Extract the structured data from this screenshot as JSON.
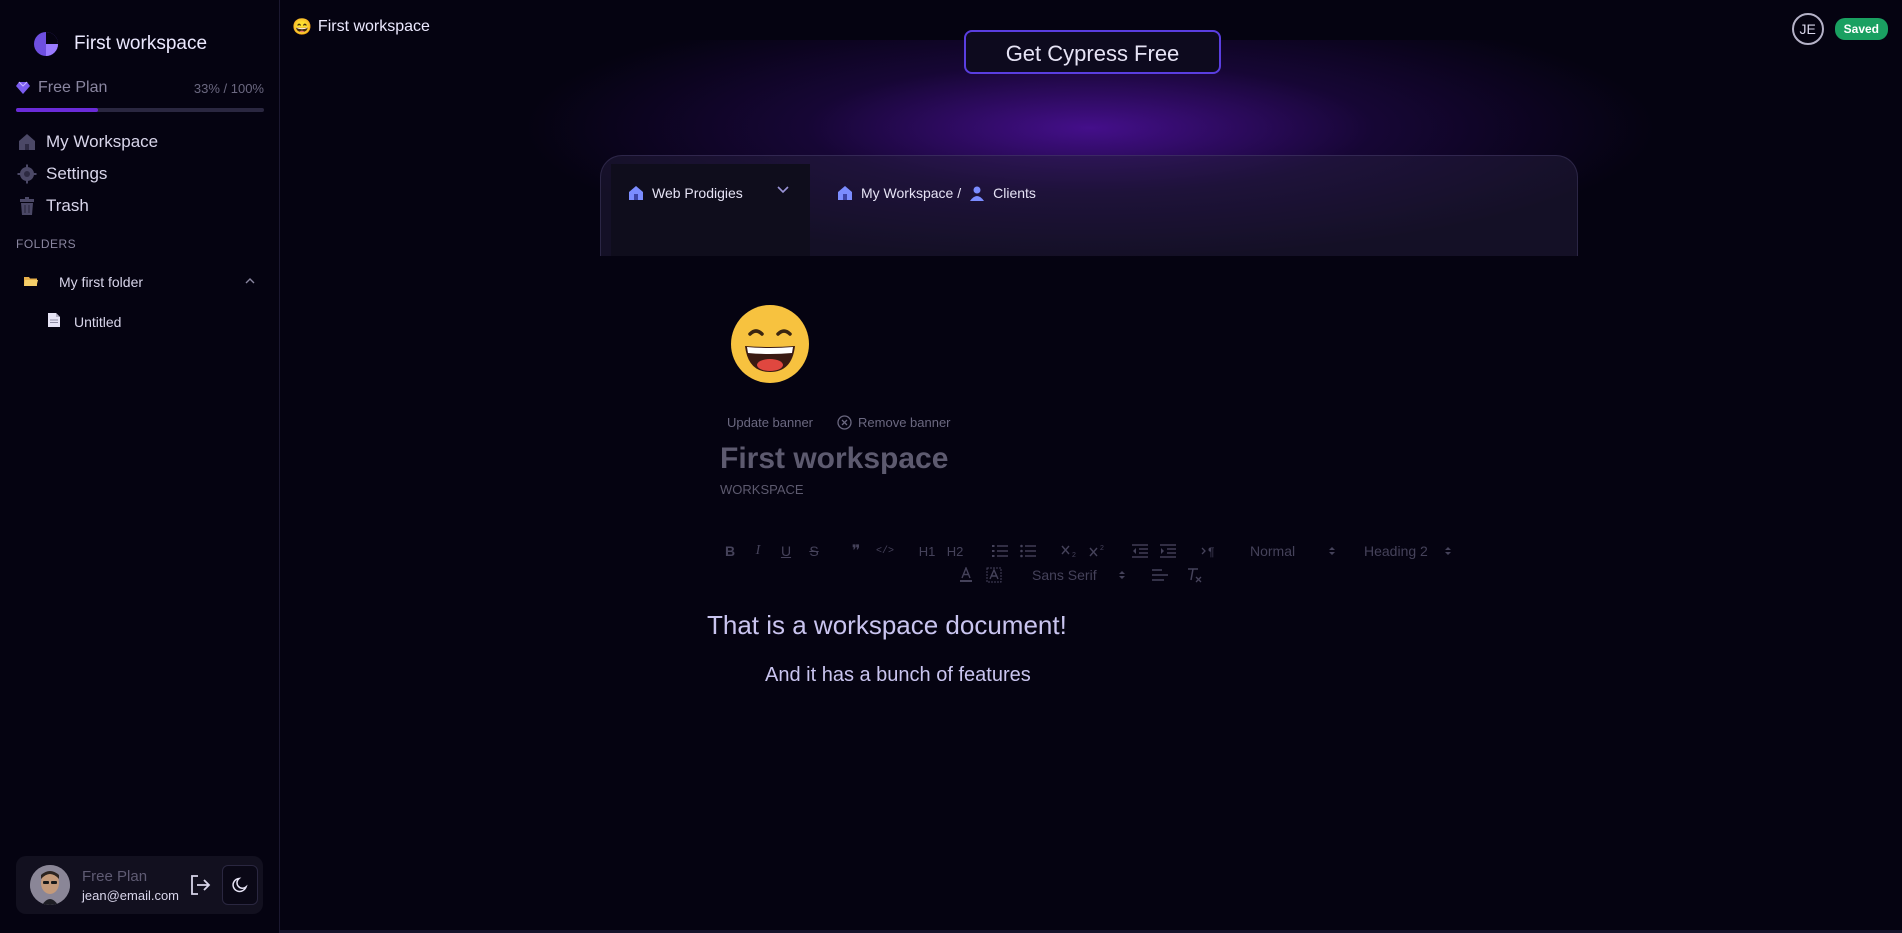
{
  "sidebar": {
    "workspace_name": "First workspace",
    "plan": {
      "label": "Free Plan",
      "usage": "33% / 100%",
      "progress_fraction": 0.33
    },
    "nav": [
      {
        "label": "My Workspace",
        "icon": "home-icon"
      },
      {
        "label": "Settings",
        "icon": "gear-icon"
      },
      {
        "label": "Trash",
        "icon": "trash-icon"
      }
    ],
    "folders_label": "FOLDERS",
    "folder": {
      "label": "My first folder",
      "icon": "folder-icon",
      "expanded": true
    },
    "file": {
      "label": "Untitled",
      "icon": "file-icon"
    },
    "user": {
      "plan": "Free Plan",
      "email": "jean@email.com"
    }
  },
  "topbar": {
    "emoji": "😄",
    "title": "First workspace",
    "avatar_initials": "JE",
    "status": "Saved"
  },
  "banner": {
    "cta": "Get Cypress Free",
    "mock_workspace": "Web Prodigies",
    "mock_crumb_root": "My Workspace /",
    "mock_crumb_page": "Clients"
  },
  "document": {
    "emoji": "😄",
    "update_banner": "Update banner",
    "remove_banner": "Remove banner",
    "title": "First workspace",
    "type": "WORKSPACE",
    "heading": "That is a workspace document!",
    "paragraph": "And it has a bunch of features"
  },
  "toolbar": {
    "header_select": "Normal",
    "size_select": "Heading 2",
    "font_select": "Sans Serif",
    "buttons": [
      "B",
      "I",
      "U",
      "S",
      "❞",
      "</>",
      "H1",
      "H2"
    ]
  },
  "colors": {
    "background": "#050311",
    "accent": "#6a2bd8",
    "saved": "#1aa061",
    "doc_text": "#c9c4ef"
  }
}
